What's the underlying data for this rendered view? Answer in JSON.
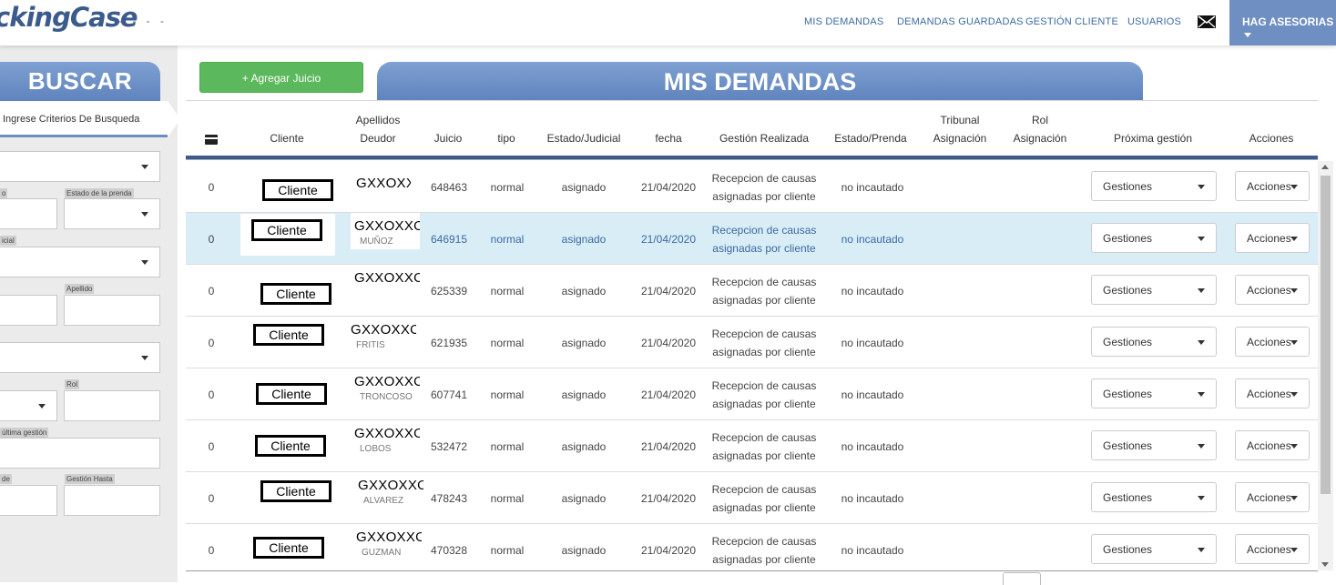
{
  "topbar": {
    "logo": "ckingCase",
    "logo_tail": "- - -  -",
    "nav": [
      "MIS DEMANDAS",
      "DEMANDAS GUARDADAS",
      "GESTIÓN CLIENTE",
      "USUARIOS"
    ],
    "user": "HAG ASESORIAS"
  },
  "sidebar": {
    "title": "BUSCAR",
    "criteria": "Ingrese Criterios De Busqueda",
    "labels": [
      "o",
      "Estado de la prenda",
      "icial",
      "Apellido",
      "Rol",
      "última gestión",
      "de",
      "Gestión Hasta"
    ]
  },
  "main": {
    "add_button": "+ Agregar Juicio",
    "title": "MIS DEMANDAS",
    "headers": {
      "cliente": "Cliente",
      "apellidos1": "Apellidos",
      "apellidos2": "Deudor",
      "juicio": "Juicio",
      "tipo": "tipo",
      "estado_judicial": "Estado/Judicial",
      "fecha": "fecha",
      "gestion": "Gestión Realizada",
      "estado_prenda": "Estado/Prenda",
      "tribunal1": "Tribunal",
      "tribunal2": "Asignación",
      "rol1": "Rol",
      "rol2": "Asignación",
      "proxima": "Próxima gestión",
      "acciones": "Acciones"
    },
    "rows": [
      {
        "num": "0",
        "cliente": "Cliente",
        "deudor": "GXXOXXO",
        "ghost": "",
        "juicio": "648463",
        "tipo": "normal",
        "estado": "asignado",
        "fecha": "21/04/2020",
        "gestion1": "Recepcion de causas",
        "gestion2": "asignadas por cliente",
        "prenda": "no incautado",
        "gestiones": "Gestiones",
        "acciones": "Acciones"
      },
      {
        "num": "0",
        "cliente": "Cliente",
        "deudor": "GXXOXXO",
        "ghost": "MUÑOZ",
        "juicio": "646915",
        "tipo": "normal",
        "estado": "asignado",
        "fecha": "21/04/2020",
        "gestion1": "Recepcion de causas",
        "gestion2": "asignadas por cliente",
        "prenda": "no incautado",
        "gestiones": "Gestiones",
        "acciones": "Acciones"
      },
      {
        "num": "0",
        "cliente": "Cliente",
        "deudor": "GXXOXXO",
        "ghost": "",
        "juicio": "625339",
        "tipo": "normal",
        "estado": "asignado",
        "fecha": "21/04/2020",
        "gestion1": "Recepcion de causas",
        "gestion2": "asignadas por cliente",
        "prenda": "no incautado",
        "gestiones": "Gestiones",
        "acciones": "Acciones"
      },
      {
        "num": "0",
        "cliente": "Cliente",
        "deudor": "GXXOXXO",
        "ghost": "FRITIS",
        "juicio": "621935",
        "tipo": "normal",
        "estado": "asignado",
        "fecha": "21/04/2020",
        "gestion1": "Recepcion de causas",
        "gestion2": "asignadas por cliente",
        "prenda": "no incautado",
        "gestiones": "Gestiones",
        "acciones": "Acciones"
      },
      {
        "num": "0",
        "cliente": "Cliente",
        "deudor": "GXXOXXO",
        "ghost": "TRONCOSO",
        "juicio": "607741",
        "tipo": "normal",
        "estado": "asignado",
        "fecha": "21/04/2020",
        "gestion1": "Recepcion de causas",
        "gestion2": "asignadas por cliente",
        "prenda": "no incautado",
        "gestiones": "Gestiones",
        "acciones": "Acciones"
      },
      {
        "num": "0",
        "cliente": "Cliente",
        "deudor": "GXXOXXO",
        "ghost": "LOBOS",
        "juicio": "532472",
        "tipo": "normal",
        "estado": "asignado",
        "fecha": "21/04/2020",
        "gestion1": "Recepcion de causas",
        "gestion2": "asignadas por cliente",
        "prenda": "no incautado",
        "gestiones": "Gestiones",
        "acciones": "Acciones"
      },
      {
        "num": "0",
        "cliente": "Cliente",
        "deudor": "GXXOXXO",
        "ghost": "ALVAREZ",
        "juicio": "478243",
        "tipo": "normal",
        "estado": "asignado",
        "fecha": "21/04/2020",
        "gestion1": "Recepcion de causas",
        "gestion2": "asignadas por cliente",
        "prenda": "no incautado",
        "gestiones": "Gestiones",
        "acciones": "Acciones"
      },
      {
        "num": "0",
        "cliente": "Cliente",
        "deudor": "GXXOXXO",
        "ghost": "GUZMAN",
        "juicio": "470328",
        "tipo": "normal",
        "estado": "asignado",
        "fecha": "21/04/2020",
        "gestion1": "Recepcion de causas",
        "gestion2": "asignadas por cliente",
        "prenda": "no incautado",
        "gestiones": "Gestiones",
        "acciones": "Acciones"
      }
    ]
  }
}
